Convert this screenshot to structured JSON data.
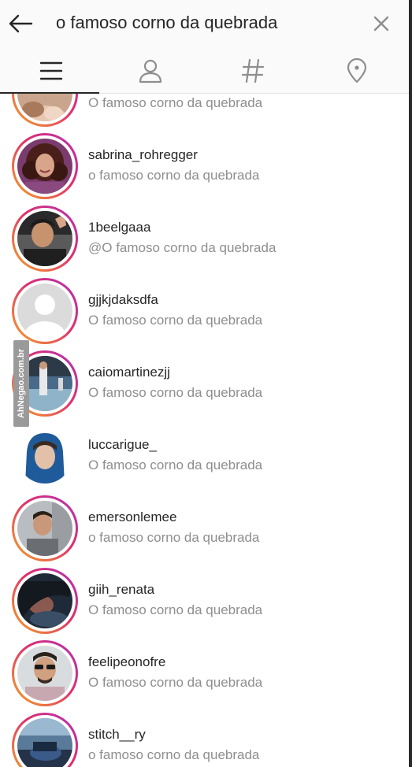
{
  "search": {
    "query": "o famoso corno da quebrada"
  },
  "icons": {
    "back": "back-arrow-icon",
    "clear": "close-icon",
    "tabs": [
      "menu-icon",
      "person-icon",
      "hashtag-icon",
      "location-pin-icon"
    ]
  },
  "tabs": [
    {
      "name": "top",
      "icon": "menu-icon",
      "selected": true
    },
    {
      "name": "accounts",
      "icon": "person-icon",
      "selected": false
    },
    {
      "name": "tags",
      "icon": "hashtag-icon",
      "selected": false
    },
    {
      "name": "places",
      "icon": "location-pin-icon",
      "selected": false
    }
  ],
  "results": [
    {
      "username": "",
      "fullname": "O famoso corno da quebrada",
      "story_ring": true
    },
    {
      "username": "sabrina_rohregger",
      "fullname": "o famoso corno da quebrada",
      "story_ring": true
    },
    {
      "username": "1beelgaaa",
      "fullname": "@O famoso corno da quebrada",
      "story_ring": true
    },
    {
      "username": "gjjkjdaksdfa",
      "fullname": "O famoso corno da quebrada",
      "story_ring": true
    },
    {
      "username": "caiomartinezjj",
      "fullname": "O famoso corno da quebrada",
      "story_ring": true
    },
    {
      "username": "luccarigue_",
      "fullname": "O famoso corno da quebrada",
      "story_ring": false
    },
    {
      "username": "emersonlemee",
      "fullname": "o famoso corno da quebrada",
      "story_ring": true
    },
    {
      "username": "giih_renata",
      "fullname": "O famoso corno da quebrada",
      "story_ring": true
    },
    {
      "username": "feelipeonofre",
      "fullname": "O famoso corno da quebrada",
      "story_ring": true
    },
    {
      "username": "stitch__ry",
      "fullname": "o famoso corno da quebrada",
      "story_ring": true
    }
  ],
  "watermark": "AhNegao.com.br",
  "colors": {
    "ring_start": "#f5a623",
    "ring_mid": "#e1306c",
    "ring_end": "#b02fb7",
    "text_primary": "#262626",
    "text_secondary": "#8e8e8e"
  }
}
